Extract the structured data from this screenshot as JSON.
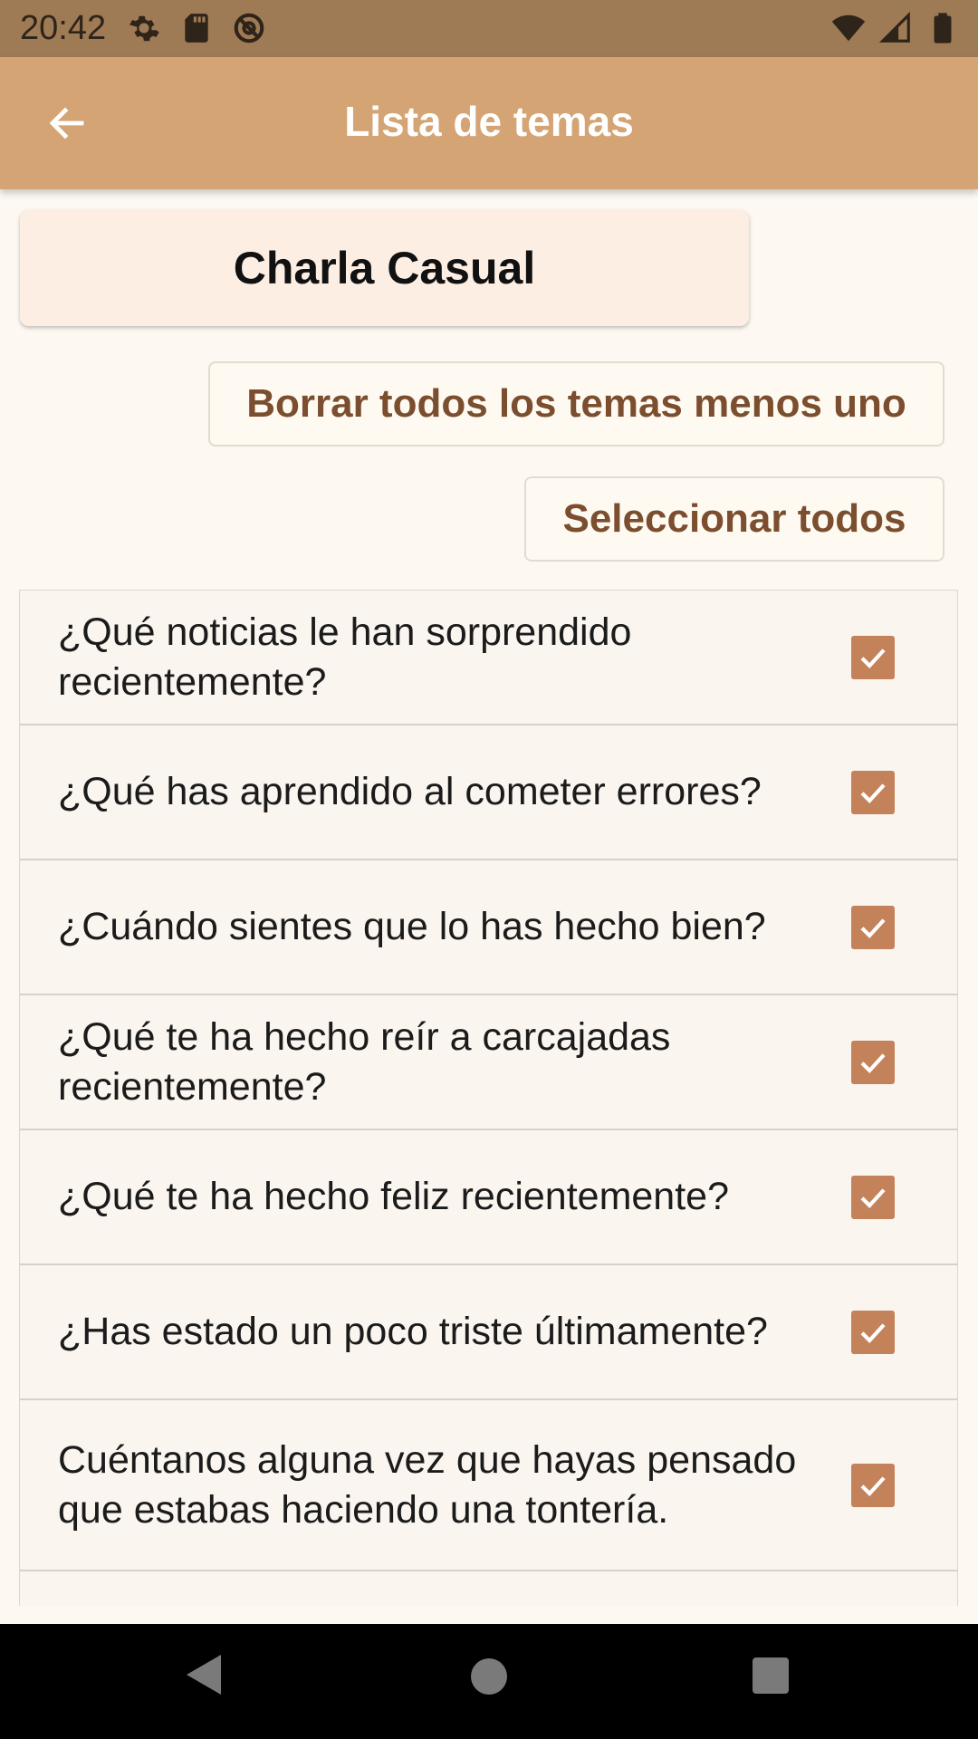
{
  "status_bar": {
    "time": "20:42",
    "left_icons": [
      "gear-icon",
      "sd-card-icon",
      "at-sign-icon"
    ],
    "right_icons": [
      "wifi-icon",
      "signal-icon",
      "battery-icon"
    ]
  },
  "app_bar": {
    "title": "Lista de temas",
    "back_icon": "arrow-left-icon"
  },
  "category": {
    "label": "Charla Casual"
  },
  "actions": {
    "delete_all_but_one": "Borrar todos los temas menos uno",
    "select_all": "Seleccionar todos"
  },
  "topics": [
    {
      "text": "¿Qué noticias le han sorprendido recientemente?",
      "checked": true
    },
    {
      "text": "¿Qué has aprendido al cometer errores?",
      "checked": true
    },
    {
      "text": "¿Cuándo sientes que lo has hecho bien?",
      "checked": true
    },
    {
      "text": "¿Qué te ha hecho reír a carcajadas recientemente?",
      "checked": true
    },
    {
      "text": "¿Qué te ha hecho feliz recientemente?",
      "checked": true
    },
    {
      "text": "¿Has estado un poco triste últimamente?",
      "checked": true
    },
    {
      "text": "Cuéntanos alguna vez que hayas pensado que estabas haciendo una tontería.",
      "checked": true
    }
  ],
  "colors": {
    "status_bar": "#9f7b55",
    "app_bar": "#d4a474",
    "accent_text": "#7a4e2e",
    "checkbox": "#c4825a",
    "background": "#fdf8f2"
  },
  "nav_bar": {
    "icons": [
      "back-triangle-icon",
      "home-circle-icon",
      "recents-square-icon"
    ]
  }
}
